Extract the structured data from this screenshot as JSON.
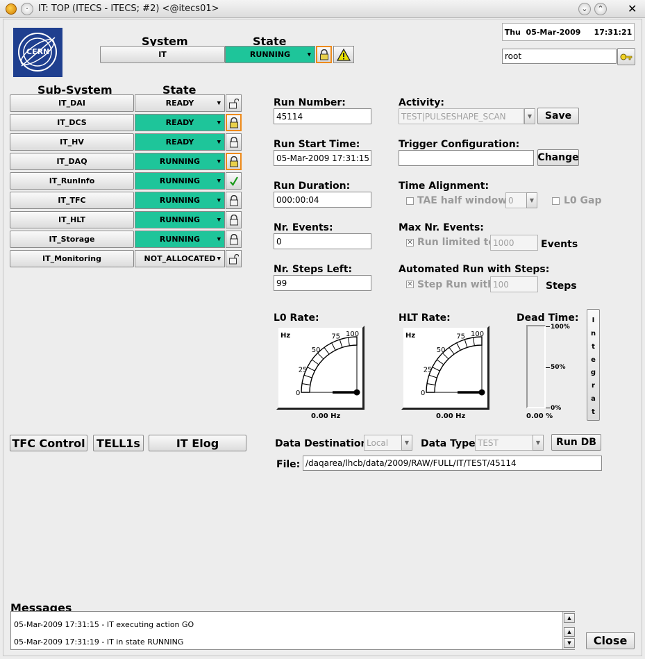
{
  "window": {
    "title": "IT: TOP (ITECS - ITECS; #2) <@itecs01>"
  },
  "header": {
    "system_label": "System",
    "state_label": "State",
    "system_name": "IT",
    "system_state": "RUNNING",
    "datetime": "Thu  05-Mar-2009     17:31:21",
    "user": "root",
    "logo_text": "CERN"
  },
  "subsystems": {
    "col_subsystem": "Sub-System",
    "col_state": "State",
    "rows": [
      {
        "name": "IT_DAI",
        "state": "READY",
        "green": false,
        "lock": "open"
      },
      {
        "name": "IT_DCS",
        "state": "READY",
        "green": true,
        "lock": "orange"
      },
      {
        "name": "IT_HV",
        "state": "READY",
        "green": true,
        "lock": "closed"
      },
      {
        "name": "IT_DAQ",
        "state": "RUNNING",
        "green": true,
        "lock": "orange"
      },
      {
        "name": "IT_RunInfo",
        "state": "RUNNING",
        "green": true,
        "lock": "check"
      },
      {
        "name": "IT_TFC",
        "state": "RUNNING",
        "green": true,
        "lock": "closed"
      },
      {
        "name": "IT_HLT",
        "state": "RUNNING",
        "green": true,
        "lock": "closed"
      },
      {
        "name": "IT_Storage",
        "state": "RUNNING",
        "green": true,
        "lock": "closed"
      },
      {
        "name": "IT_Monitoring",
        "state": "NOT_ALLOCATED",
        "green": false,
        "lock": "open"
      }
    ]
  },
  "run": {
    "run_number_label": "Run Number:",
    "run_number": "45114",
    "start_time_label": "Run Start Time:",
    "start_time": "05-Mar-2009 17:31:15",
    "duration_label": "Run Duration:",
    "duration": "000:00:04",
    "events_label": "Nr. Events:",
    "events": "0",
    "steps_left_label": "Nr. Steps Left:",
    "steps_left": "99"
  },
  "config": {
    "activity_label": "Activity:",
    "activity": "TEST|PULSESHAPE_SCAN",
    "save_label": "Save",
    "trigger_label": "Trigger Configuration:",
    "trigger_value": "",
    "change_label": "Change",
    "time_align_label": "Time Alignment:",
    "tae_label": "TAE half window",
    "tae_value": "0",
    "l0gap_label": "L0 Gap",
    "max_events_label": "Max Nr. Events:",
    "run_limited_label": "Run limited to",
    "run_limited_value": "1000",
    "events_unit": "Events",
    "auto_run_label": "Automated Run with Steps:",
    "step_run_label": "Step Run with",
    "step_run_value": "100",
    "steps_unit": "Steps"
  },
  "rates": {
    "l0_label": "L0 Rate:",
    "hlt_label": "HLT Rate:",
    "dead_label": "Dead Time:",
    "unit": "Hz",
    "ticks": [
      "0",
      "25",
      "50",
      "75",
      "100"
    ],
    "l0_value": "0.00 Hz",
    "hlt_value": "0.00 Hz",
    "dead_value": "0.00 %",
    "dead_ticks": [
      "100%",
      "50%",
      "0%"
    ],
    "integrate_label": [
      "I",
      "n",
      "t",
      "e",
      "g",
      "r",
      "a",
      "t"
    ]
  },
  "buttons": {
    "tfc": "TFC Control",
    "tell1": "TELL1s",
    "elog": "IT Elog",
    "rundb": "Run DB",
    "close": "Close"
  },
  "data": {
    "dest_label": "Data Destination:",
    "dest": "Local",
    "type_label": "Data Type:",
    "type": "TEST",
    "file_label": "File:",
    "file": "/daqarea/lhcb/data/2009/RAW/FULL/IT/TEST/45114"
  },
  "messages": {
    "label": "Messages",
    "lines": [
      "05-Mar-2009 17:31:15 - IT executing action GO",
      "05-Mar-2009 17:31:19 - IT in state RUNNING"
    ]
  },
  "colors": {
    "running_green": "#1ec59a",
    "lock_orange": "#ee8a1a",
    "cern_blue": "#1f3f8f"
  }
}
